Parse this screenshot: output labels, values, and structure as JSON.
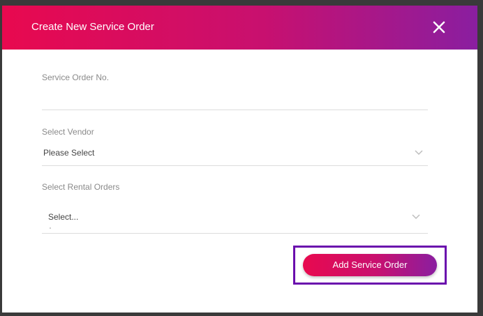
{
  "modal": {
    "title": "Create New Service Order",
    "close_icon": "close-icon"
  },
  "form": {
    "service_order_no": {
      "label": "Service Order No.",
      "value": "",
      "placeholder": ""
    },
    "vendor": {
      "label": "Select Vendor",
      "selected": "Please Select",
      "icon": "chevron-down-icon"
    },
    "rental_orders": {
      "label": "Select Rental Orders",
      "selected": "Select...",
      "icon": "chevron-down-icon"
    },
    "submit_label": "Add Service Order"
  },
  "colors": {
    "gradient_start": "#e8094f",
    "gradient_end": "#8a1ea0",
    "highlight": "#6a0dad"
  }
}
